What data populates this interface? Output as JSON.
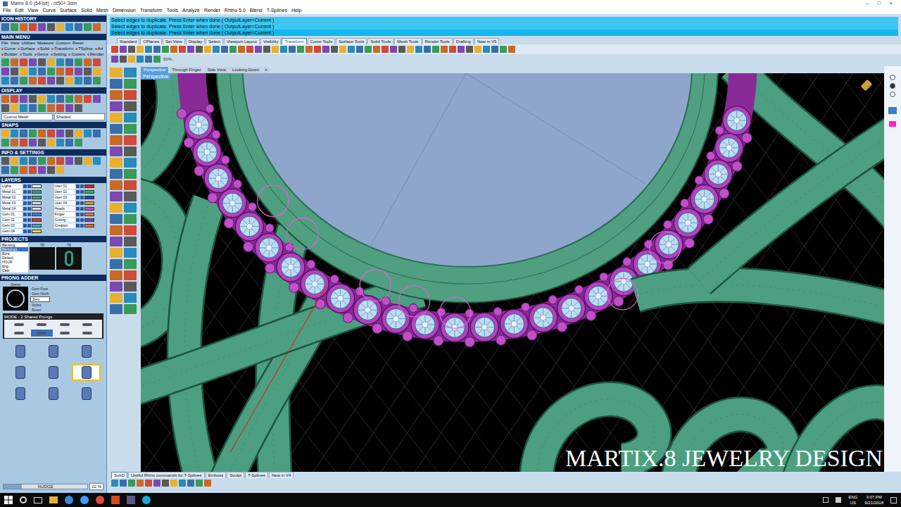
{
  "window": {
    "title": "Matrix 8.0 (64-bit) - nt50+.3dm",
    "controls": [
      "–",
      "□",
      "×"
    ]
  },
  "menu": [
    "File",
    "Edit",
    "View",
    "Curve",
    "Surface",
    "Solid",
    "Mesh",
    "Dimension",
    "Transform",
    "Tools",
    "Analyze",
    "Render",
    "Rhino 5.0",
    "Blend",
    "T-Splines",
    "Help"
  ],
  "command_lines": [
    "Select edges to duplicate. Press Enter when done ( OutputLayer=Current )",
    "Select edges to duplicate. Press Enter when done ( OutputLayer=Current )",
    "Select edges to duplicate. Press Enter when done ( OutputLayer=Current )"
  ],
  "toolbar_tabs": [
    {
      "label": "Standard",
      "selected": false
    },
    {
      "label": "CPlanes",
      "selected": false
    },
    {
      "label": "Set View",
      "selected": false
    },
    {
      "label": "Display",
      "selected": false
    },
    {
      "label": "Select",
      "selected": false
    },
    {
      "label": "Viewport Layout",
      "selected": false
    },
    {
      "label": "Visibility",
      "selected": false
    },
    {
      "label": "Transform",
      "selected": true
    },
    {
      "label": "Curve Tools",
      "selected": false
    },
    {
      "label": "Surface Tools",
      "selected": false
    },
    {
      "label": "Solid Tools",
      "selected": false
    },
    {
      "label": "Mesh Tools",
      "selected": false
    },
    {
      "label": "Render Tools",
      "selected": false
    },
    {
      "label": "Drafting",
      "selected": false
    },
    {
      "label": "New in V5",
      "selected": false
    }
  ],
  "zoom": "50%",
  "viewport_tabs": [
    {
      "label": "Perspective",
      "selected": true
    },
    {
      "label": "Through Finger",
      "selected": false
    },
    {
      "label": "Side View",
      "selected": false
    },
    {
      "label": "Looking Down",
      "selected": false
    }
  ],
  "viewport_add": "+",
  "viewport_label": "Perspective",
  "sidebar": {
    "icon_history": "ICON HISTORY",
    "main_menu": "MAIN MENU",
    "main_menu_rows": [
      [
        "File",
        "View",
        "Utilities",
        "Measure",
        "Custom",
        "Reset"
      ],
      [
        "Curve",
        "Surface",
        "Solid",
        "Transform",
        "TSpline",
        "Art"
      ],
      [
        "Builder",
        "Tools",
        "Gems",
        "Setting",
        "Cutters",
        "Render"
      ]
    ],
    "display": "DISPLAY",
    "display_modes": [
      "Cosmo Mesh",
      "Shaded"
    ],
    "snaps": "SNAPS",
    "info": "INFO & SETTINGS",
    "layers": "LAYERS",
    "projects": "PROJECTS",
    "prong_adder": "PRONG ADDER"
  },
  "layers_left": [
    {
      "name": "Lights",
      "color": "#ffffff"
    },
    {
      "name": "Metal 01",
      "color": "#3fa07a"
    },
    {
      "name": "Metal 02",
      "color": "#3fa07a"
    },
    {
      "name": "Metal 03",
      "color": "#e0e0e0"
    },
    {
      "name": "Metal 04",
      "color": "#e0e0e0"
    },
    {
      "name": "Gem 01",
      "color": "#4a80d8"
    },
    {
      "name": "Gem 02",
      "color": "#d83a3a"
    },
    {
      "name": "Gem 03",
      "color": "#3ab0e0"
    },
    {
      "name": "Gem 04",
      "color": "#e0e040"
    }
  ],
  "layers_right": [
    {
      "name": "User 01",
      "color": "#e02020"
    },
    {
      "name": "User 02",
      "color": "#20c040"
    },
    {
      "name": "User 03",
      "color": "#2040e0"
    },
    {
      "name": "User 04",
      "color": "#e0a020"
    },
    {
      "name": "Heads",
      "color": "#e040c0"
    },
    {
      "name": "Finger",
      "color": "#e08040"
    },
    {
      "name": "Cutting",
      "color": "#8040c0"
    },
    {
      "name": "Creation",
      "color": "#e07020"
    }
  ],
  "projects": [
    {
      "name": "Bantong",
      "selected": false
    },
    {
      "name": "Bantong1",
      "selected": true
    },
    {
      "name": "Bora",
      "selected": false
    },
    {
      "name": "Default",
      "selected": false
    },
    {
      "name": "HOUR",
      "selected": false
    },
    {
      "name": "Eng",
      "selected": false
    },
    {
      "name": "Cats",
      "selected": false
    }
  ],
  "project_thumbs": [
    "78",
    "79"
  ],
  "prong_adder": {
    "gem_label": "Gems",
    "options": [
      {
        "label": "Gem Flow",
        "selected": false
      },
      {
        "label": "Gem North",
        "selected": false
      },
      {
        "label": "Zero",
        "selected": true
      },
      {
        "label": "Styles",
        "selected": false
      },
      {
        "label": "Reset",
        "selected": false
      }
    ],
    "mode": "MODE - 2 Shared Prongs",
    "mode_icons": [
      {
        "selected": false
      },
      {
        "selected": false
      },
      {
        "selected": false
      },
      {
        "selected": false
      },
      {
        "selected": false
      },
      {
        "selected": true
      },
      {
        "selected": false
      },
      {
        "selected": false
      }
    ],
    "tools": [
      {
        "selected": false
      },
      {
        "selected": false
      },
      {
        "selected": false
      },
      {
        "selected": false
      },
      {
        "selected": false
      },
      {
        "selected": true
      },
      {
        "selected": false
      },
      {
        "selected": false
      },
      {
        "selected": false
      }
    ],
    "nudge_label": "NUDGE",
    "nudge_value": "22 %",
    "nudge_level": 0.22
  },
  "bottom_tabs": [
    {
      "label": "SubD",
      "selected": true
    },
    {
      "label": "Useful Rhino commands for T-Splines",
      "selected": false
    },
    {
      "label": "Emboss",
      "selected": false
    },
    {
      "label": "Sculpt",
      "selected": false
    },
    {
      "label": "T-Splines",
      "selected": false
    },
    {
      "label": "New in V4",
      "selected": false
    }
  ],
  "watermark": "MARTIX.8 JEWELRY DESIGN",
  "taskbar": {
    "lang": "ENG",
    "region": "US",
    "time": "3:07 PM",
    "date": "9/21/2018"
  }
}
